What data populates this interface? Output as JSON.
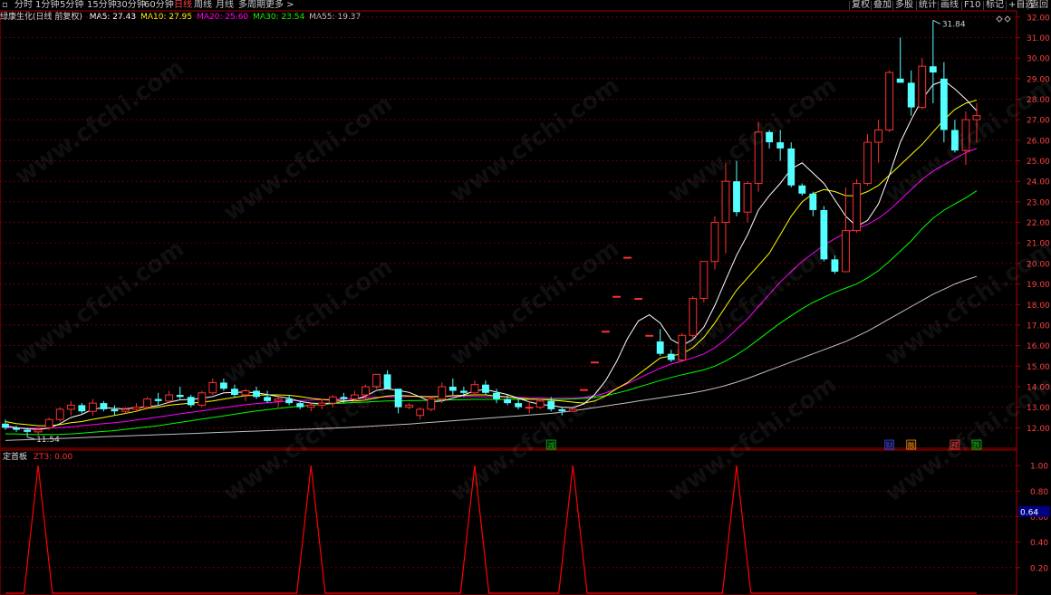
{
  "colors": {
    "up": "#ff3030",
    "down": "#54ffff",
    "ma5": "#ffffff",
    "ma10": "#ffff00",
    "ma20": "#ff00ff",
    "ma30": "#00ff00",
    "ma55": "#c0c0c0",
    "grid": "#7a0000",
    "axis": "#aa0000",
    "ind": "#ff0000"
  },
  "toolbar": {
    "left": [
      "分时",
      "1分钟",
      "5分钟",
      "15分钟",
      "30分钟",
      "60分钟",
      "日线",
      "周线",
      "月线",
      "多周期",
      "更多 >"
    ],
    "active_index": 6,
    "right": [
      "复权",
      "叠加",
      "多股",
      "统计",
      "画线",
      "F10",
      "标记",
      "+自选",
      "返回"
    ]
  },
  "stock": {
    "name": "绿康生化(日线 前复权)"
  },
  "ma_legend": [
    {
      "label": "MA5: 27.43",
      "color": "#ffffff"
    },
    {
      "label": "MA10: 27.95",
      "color": "#ffff00"
    },
    {
      "label": "MA20: 25.60",
      "color": "#ff00ff"
    },
    {
      "label": "MA30: 23.54",
      "color": "#00ff00"
    },
    {
      "label": "MA55: 19.37",
      "color": "#c0c0c0"
    }
  ],
  "price_axis": [
    "32.00",
    "31.00",
    "30.00",
    "29.00",
    "28.00",
    "27.00",
    "26.00",
    "25.00",
    "24.00",
    "23.00",
    "22.00",
    "21.00",
    "20.00",
    "19.00",
    "18.00",
    "17.00",
    "16.00",
    "15.00",
    "14.00",
    "13.00",
    "12.00"
  ],
  "high_label": "31.84",
  "low_label": "11.54",
  "event_markers": [
    {
      "text": "减",
      "color": "#00cc00"
    },
    {
      "text": "财",
      "color": "#4040ff"
    },
    {
      "text": "融",
      "color": "#ff8800"
    },
    {
      "text": "预",
      "color": "#ff3030"
    },
    {
      "text": "跌",
      "color": "#00cc00"
    }
  ],
  "indicator": {
    "name": "定首板",
    "value_label": "ZT3: 0.00",
    "axis": [
      "1.00",
      "0.80",
      "0.60",
      "0.40",
      "0.20"
    ],
    "cursor_value": "0.64"
  },
  "watermark": "www.cfchi.com",
  "chart_data": {
    "type": "candlestick",
    "y_range": [
      11.0,
      32.3
    ],
    "candles": [
      [
        12.2,
        12.4,
        11.9,
        12.0
      ],
      [
        12.0,
        12.1,
        11.8,
        11.9
      ],
      [
        11.9,
        12.0,
        11.54,
        11.8
      ],
      [
        11.8,
        12.0,
        11.7,
        11.9
      ],
      [
        12.0,
        12.5,
        11.9,
        12.4
      ],
      [
        12.4,
        13.0,
        12.3,
        12.9
      ],
      [
        12.9,
        13.3,
        12.6,
        13.1
      ],
      [
        13.1,
        13.2,
        12.7,
        12.8
      ],
      [
        12.8,
        13.4,
        12.6,
        13.2
      ],
      [
        13.2,
        13.3,
        12.8,
        12.9
      ],
      [
        12.9,
        13.1,
        12.6,
        12.8
      ],
      [
        12.8,
        13.0,
        12.7,
        12.9
      ],
      [
        12.9,
        13.2,
        12.8,
        13.0
      ],
      [
        13.0,
        13.5,
        12.9,
        13.4
      ],
      [
        13.4,
        13.7,
        13.1,
        13.3
      ],
      [
        13.3,
        13.8,
        13.2,
        13.6
      ],
      [
        13.6,
        14.0,
        13.4,
        13.5
      ],
      [
        13.5,
        13.6,
        13.0,
        13.1
      ],
      [
        13.1,
        13.8,
        13.0,
        13.7
      ],
      [
        13.7,
        14.4,
        13.6,
        14.2
      ],
      [
        14.2,
        14.4,
        13.8,
        13.9
      ],
      [
        13.9,
        14.1,
        13.5,
        13.6
      ],
      [
        13.6,
        13.9,
        13.3,
        13.8
      ],
      [
        13.8,
        14.0,
        13.4,
        13.5
      ],
      [
        13.5,
        13.8,
        13.2,
        13.3
      ],
      [
        13.3,
        13.5,
        13.0,
        13.4
      ],
      [
        13.4,
        13.6,
        13.1,
        13.2
      ],
      [
        13.2,
        13.3,
        12.9,
        13.0
      ],
      [
        13.0,
        13.2,
        12.8,
        13.1
      ],
      [
        13.1,
        13.4,
        12.9,
        13.2
      ],
      [
        13.2,
        13.6,
        13.0,
        13.5
      ],
      [
        13.5,
        13.7,
        13.2,
        13.4
      ],
      [
        13.4,
        13.8,
        13.3,
        13.6
      ],
      [
        13.6,
        14.1,
        13.4,
        14.0
      ],
      [
        14.0,
        14.6,
        13.9,
        14.6
      ],
      [
        14.6,
        14.8,
        13.9,
        13.9
      ],
      [
        13.9,
        13.0,
        12.7,
        13.0
      ],
      [
        13.0,
        13.2,
        12.9,
        13.1
      ],
      [
        12.6,
        13.0,
        12.4,
        12.9
      ],
      [
        12.9,
        13.5,
        12.8,
        13.4
      ],
      [
        13.4,
        14.2,
        13.2,
        14.0
      ],
      [
        14.0,
        14.4,
        13.6,
        13.8
      ],
      [
        13.8,
        14.0,
        13.5,
        13.7
      ],
      [
        13.7,
        14.3,
        13.6,
        14.1
      ],
      [
        14.1,
        14.3,
        13.6,
        13.7
      ],
      [
        13.7,
        13.9,
        13.2,
        13.4
      ],
      [
        13.4,
        13.6,
        13.1,
        13.2
      ],
      [
        13.2,
        13.4,
        12.9,
        13.0
      ],
      [
        13.0,
        13.3,
        12.7,
        13.0
      ],
      [
        13.0,
        13.4,
        12.9,
        13.3
      ],
      [
        13.3,
        13.5,
        12.8,
        12.9
      ],
      [
        12.9,
        13.0,
        12.6,
        12.8
      ],
      [
        12.8,
        12.9,
        12.8,
        12.9
      ],
      [
        13.86,
        13.86,
        13.86,
        13.86
      ],
      [
        15.2,
        15.2,
        15.2,
        15.2
      ],
      [
        16.7,
        16.7,
        16.7,
        16.7
      ],
      [
        18.4,
        18.4,
        18.4,
        18.4
      ],
      [
        20.3,
        20.3,
        20.3,
        20.3
      ],
      [
        18.3,
        18.3,
        18.3,
        18.3
      ],
      [
        16.5,
        16.5,
        16.5,
        16.5
      ],
      [
        16.2,
        16.8,
        15.5,
        15.6
      ],
      [
        15.6,
        15.8,
        15.2,
        15.3
      ],
      [
        15.3,
        16.6,
        15.2,
        16.5
      ],
      [
        16.5,
        18.4,
        16.3,
        18.3
      ],
      [
        18.3,
        20.1,
        18.1,
        20.1
      ],
      [
        20.1,
        22.3,
        19.7,
        22.0
      ],
      [
        22.0,
        24.9,
        20.5,
        24.0
      ],
      [
        24.0,
        25.0,
        22.3,
        22.5
      ],
      [
        22.5,
        24.0,
        22.0,
        23.9
      ],
      [
        23.9,
        26.9,
        23.5,
        26.4
      ],
      [
        26.4,
        26.5,
        25.6,
        25.9
      ],
      [
        25.9,
        26.5,
        25.0,
        25.6
      ],
      [
        25.6,
        25.9,
        23.7,
        23.8
      ],
      [
        23.8,
        23.9,
        23.3,
        23.4
      ],
      [
        23.4,
        23.5,
        22.3,
        22.6
      ],
      [
        22.6,
        22.8,
        20.1,
        20.2
      ],
      [
        20.2,
        20.4,
        19.5,
        19.6
      ],
      [
        19.6,
        23.7,
        19.8,
        21.6
      ],
      [
        21.6,
        24.1,
        21.5,
        23.9
      ],
      [
        23.9,
        26.3,
        23.8,
        25.9
      ],
      [
        25.9,
        27.0,
        24.9,
        26.5
      ],
      [
        26.5,
        29.4,
        26.4,
        29.3
      ],
      [
        29.0,
        31.0,
        29.0,
        28.8
      ],
      [
        28.8,
        29.4,
        27.2,
        27.6
      ],
      [
        27.6,
        30.0,
        27.5,
        29.6
      ],
      [
        29.6,
        31.84,
        27.8,
        29.3
      ],
      [
        29.0,
        29.8,
        25.9,
        26.5
      ],
      [
        26.5,
        27.0,
        25.4,
        25.5
      ],
      [
        25.5,
        27.4,
        24.8,
        27.0
      ],
      [
        27.0,
        27.8,
        25.9,
        27.2
      ]
    ],
    "ma5": [
      12.1,
      12.0,
      11.95,
      11.92,
      11.98,
      12.2,
      12.5,
      12.65,
      12.9,
      12.98,
      12.94,
      12.92,
      12.98,
      13.02,
      13.08,
      13.24,
      13.36,
      13.38,
      13.44,
      13.52,
      13.7,
      13.72,
      13.74,
      13.7,
      13.62,
      13.52,
      13.44,
      13.28,
      13.2,
      13.18,
      13.2,
      13.28,
      13.36,
      13.54,
      13.82,
      13.9,
      13.82,
      13.72,
      13.5,
      13.26,
      13.3,
      13.44,
      13.6,
      13.8,
      13.86,
      13.74,
      13.62,
      13.44,
      13.26,
      13.14,
      13.08,
      13.0,
      12.98,
      13.16,
      13.62,
      14.3,
      15.22,
      16.35,
      17.2,
      17.5,
      17.1,
      16.3,
      16.0,
      16.3,
      16.9,
      17.95,
      19.2,
      20.4,
      21.4,
      22.6,
      23.3,
      23.9,
      24.6,
      24.9,
      24.4,
      23.9,
      23.1,
      22.3,
      21.8,
      22.1,
      22.9,
      24.3,
      25.9,
      27.0,
      28.0,
      28.7,
      28.9,
      28.5,
      28.0,
      27.43
    ],
    "ma10": [
      12.3,
      12.2,
      12.15,
      12.1,
      12.1,
      12.15,
      12.25,
      12.3,
      12.41,
      12.5,
      12.6,
      12.7,
      12.8,
      12.95,
      13.0,
      13.1,
      13.15,
      13.2,
      13.25,
      13.3,
      13.4,
      13.48,
      13.56,
      13.58,
      13.6,
      13.6,
      13.58,
      13.52,
      13.44,
      13.38,
      13.34,
      13.32,
      13.3,
      13.35,
      13.45,
      13.55,
      13.58,
      13.55,
      13.52,
      13.5,
      13.52,
      13.56,
      13.58,
      13.6,
      13.6,
      13.55,
      13.5,
      13.44,
      13.4,
      13.38,
      13.34,
      13.3,
      13.25,
      13.2,
      13.3,
      13.55,
      13.9,
      14.2,
      14.6,
      15.0,
      15.4,
      15.5,
      15.6,
      15.9,
      16.4,
      17.1,
      17.9,
      18.7,
      19.3,
      19.9,
      20.5,
      21.4,
      22.3,
      23.0,
      23.4,
      23.6,
      23.5,
      23.3,
      23.3,
      23.5,
      23.8,
      24.3,
      24.8,
      25.3,
      25.8,
      26.4,
      27.0,
      27.5,
      27.8,
      27.95
    ],
    "ma20": [
      12.0,
      12.0,
      11.98,
      11.97,
      11.98,
      12.0,
      12.04,
      12.1,
      12.15,
      12.2,
      12.25,
      12.3,
      12.38,
      12.45,
      12.52,
      12.6,
      12.68,
      12.75,
      12.82,
      12.9,
      12.98,
      13.05,
      13.12,
      13.18,
      13.22,
      13.26,
      13.3,
      13.33,
      13.35,
      13.37,
      13.38,
      13.4,
      13.42,
      13.45,
      13.48,
      13.5,
      13.51,
      13.52,
      13.53,
      13.53,
      13.53,
      13.52,
      13.52,
      13.52,
      13.51,
      13.5,
      13.49,
      13.48,
      13.46,
      13.45,
      13.44,
      13.44,
      13.45,
      13.48,
      13.55,
      13.7,
      13.9,
      14.15,
      14.4,
      14.65,
      14.9,
      15.1,
      15.25,
      15.4,
      15.6,
      15.9,
      16.3,
      16.8,
      17.3,
      17.9,
      18.5,
      19.1,
      19.6,
      20.1,
      20.5,
      20.9,
      21.2,
      21.5,
      21.7,
      21.9,
      22.2,
      22.6,
      23.1,
      23.6,
      24.1,
      24.5,
      24.8,
      25.1,
      25.4,
      25.6
    ],
    "ma30": [
      11.7,
      11.7,
      11.68,
      11.67,
      11.67,
      11.68,
      11.7,
      11.74,
      11.78,
      11.82,
      11.86,
      11.92,
      11.98,
      12.04,
      12.1,
      12.18,
      12.26,
      12.34,
      12.42,
      12.5,
      12.58,
      12.66,
      12.74,
      12.82,
      12.88,
      12.94,
      13.0,
      13.05,
      13.1,
      13.14,
      13.17,
      13.2,
      13.23,
      13.25,
      13.28,
      13.3,
      13.31,
      13.32,
      13.33,
      13.34,
      13.35,
      13.36,
      13.37,
      13.38,
      13.38,
      13.38,
      13.38,
      13.38,
      13.38,
      13.38,
      13.38,
      13.38,
      13.4,
      13.43,
      13.48,
      13.56,
      13.68,
      13.82,
      13.98,
      14.14,
      14.3,
      14.45,
      14.58,
      14.7,
      14.82,
      15.0,
      15.25,
      15.55,
      15.9,
      16.3,
      16.7,
      17.1,
      17.45,
      17.8,
      18.1,
      18.35,
      18.6,
      18.8,
      19.0,
      19.3,
      19.65,
      20.1,
      20.6,
      21.1,
      21.7,
      22.2,
      22.6,
      22.9,
      23.2,
      23.54
    ],
    "ma55": [
      11.38,
      11.4,
      11.42,
      11.44,
      11.46,
      11.48,
      11.5,
      11.52,
      11.54,
      11.56,
      11.58,
      11.6,
      11.62,
      11.64,
      11.66,
      11.68,
      11.7,
      11.72,
      11.74,
      11.76,
      11.78,
      11.8,
      11.82,
      11.84,
      11.86,
      11.88,
      11.9,
      11.92,
      11.94,
      11.96,
      11.98,
      12.0,
      12.03,
      12.06,
      12.09,
      12.12,
      12.15,
      12.18,
      12.22,
      12.26,
      12.3,
      12.34,
      12.38,
      12.42,
      12.46,
      12.5,
      12.54,
      12.58,
      12.62,
      12.66,
      12.7,
      12.76,
      12.82,
      12.9,
      12.98,
      13.06,
      13.14,
      13.22,
      13.3,
      13.38,
      13.46,
      13.54,
      13.62,
      13.7,
      13.8,
      13.92,
      14.06,
      14.22,
      14.4,
      14.6,
      14.8,
      15.0,
      15.2,
      15.4,
      15.6,
      15.8,
      16.0,
      16.2,
      16.45,
      16.7,
      17.0,
      17.3,
      17.6,
      17.9,
      18.2,
      18.5,
      18.75,
      19.0,
      19.2,
      19.37
    ],
    "indicator_spikes": [
      3,
      28,
      43,
      52,
      67
    ],
    "ind_range": [
      0,
      1.1
    ]
  }
}
